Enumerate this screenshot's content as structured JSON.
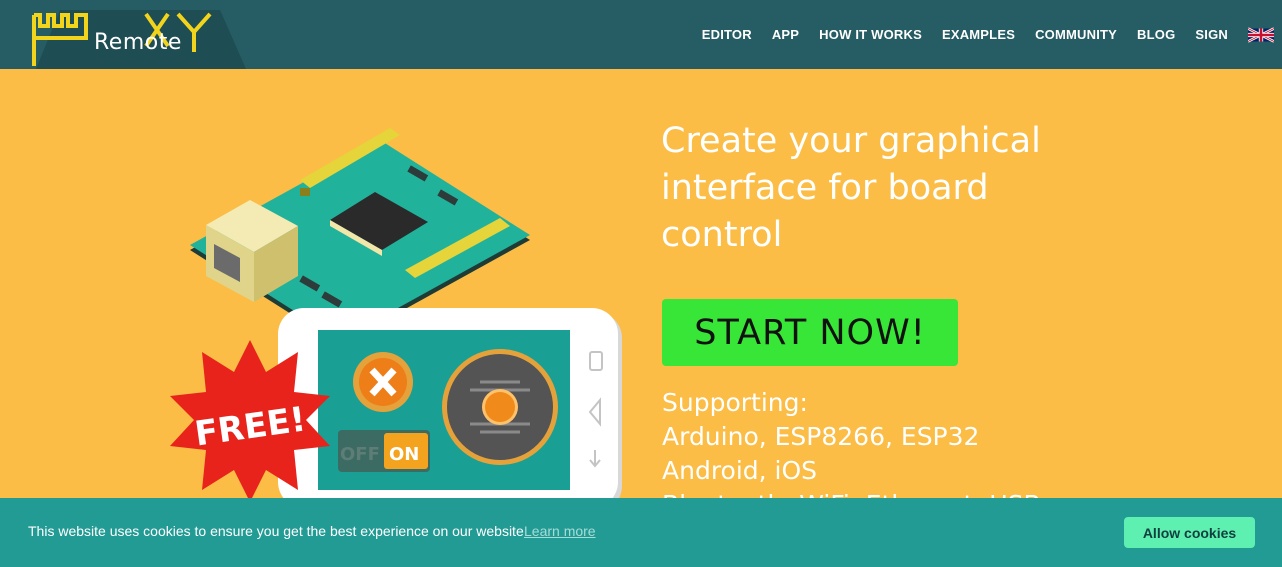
{
  "header": {
    "logo_text": "Remote",
    "nav": [
      "EDITOR",
      "APP",
      "HOW IT WORKS",
      "EXAMPLES",
      "COMMUNITY",
      "BLOG",
      "SIGN"
    ],
    "language_icon": "uk-flag-icon"
  },
  "hero": {
    "title_line1": "Create your graphical",
    "title_line2": "interface for board",
    "title_line3": "control",
    "cta_label": "START NOW!",
    "support_label": "Supporting:",
    "support_boards": "Arduino, ESP8266, ESP32",
    "support_platforms": "Android, iOS",
    "support_connections": "Bluetooth, WiFi, Ethernet, USB",
    "badge_text": "FREE!",
    "toggle_off": "OFF",
    "toggle_on": "ON"
  },
  "cookie": {
    "message": "This website uses cookies to ensure you get the best experience on our website",
    "learn_more": "Learn more",
    "allow": "Allow cookies"
  },
  "colors": {
    "header_bg": "#265c64",
    "hero_bg": "#fbbd45",
    "cta_bg": "#37e636",
    "cookie_bg": "#229b95",
    "cookie_btn": "#5ef0b0",
    "logo_yellow": "#f2d41c"
  }
}
